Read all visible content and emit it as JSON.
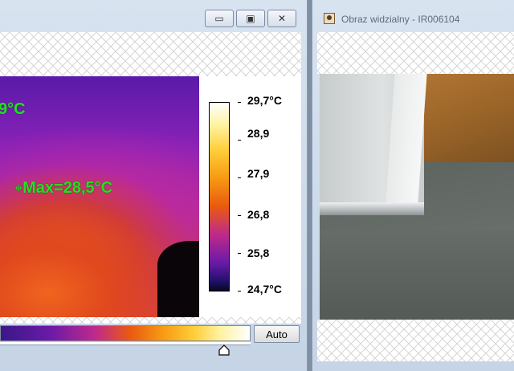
{
  "left_window": {
    "title_buttons": [
      {
        "icon": "minimize-icon",
        "glyph": "▭"
      },
      {
        "icon": "maximize-icon",
        "glyph": "▣"
      },
      {
        "icon": "close-icon",
        "glyph": "✕"
      }
    ],
    "thermal": {
      "spot_label_partial": "9°C",
      "max_label": "Max=28,5°C",
      "crosshair_icon": "crosshair-icon"
    },
    "scale": {
      "labels": [
        "29,7°C",
        "28,9",
        "27,9",
        "26,8",
        "25,8",
        "24,7°C"
      ]
    },
    "palette": {
      "auto_button": "Auto"
    }
  },
  "right_window": {
    "title": "Obraz widzialny - IR006104",
    "title_icon": "camera-icon"
  },
  "colors": {
    "thermal_label": "#21e221",
    "window_chrome": "#c5d4e6"
  }
}
